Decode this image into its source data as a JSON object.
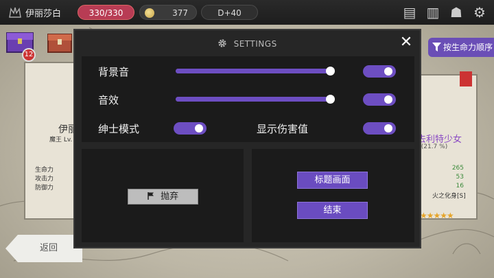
{
  "topbar": {
    "player_name": "伊丽莎白",
    "hp": "330/330",
    "gold": "377",
    "day": "D+40",
    "icons": [
      "notes-icon",
      "book-icon",
      "demon-mask-icon",
      "gear-icon"
    ]
  },
  "chest_badge": "12",
  "sort_button_label": "按生命力顺序",
  "left_card": {
    "name": "伊丽",
    "subtitle": "魔王 Lv.",
    "stats": [
      "生命力",
      "攻击力",
      "防御力"
    ]
  },
  "right_card": {
    "name": "去利特少女",
    "subtitle": "8(21.7 %)",
    "values": [
      "265",
      "53",
      "16"
    ],
    "trait": "火之化身[S]",
    "stars": "★★★★★"
  },
  "back_button": "返回",
  "settings": {
    "title": "SETTINGS",
    "bgm_label": "背景音",
    "sfx_label": "音效",
    "gentleman_label": "绅士模式",
    "damage_label": "显示伤害值",
    "bgm_level": 1.0,
    "sfx_level": 1.0,
    "bgm_enabled": true,
    "sfx_enabled": true,
    "gentleman_mode": true,
    "show_damage": true,
    "abandon_button": "抛弃",
    "title_screen_button": "标题画面",
    "quit_button": "结束"
  },
  "colors": {
    "accent": "#6d4ec2",
    "hp_pill": "#b83c54",
    "dialog_bg": "#262626",
    "panel_bg": "#1b1b1b"
  }
}
